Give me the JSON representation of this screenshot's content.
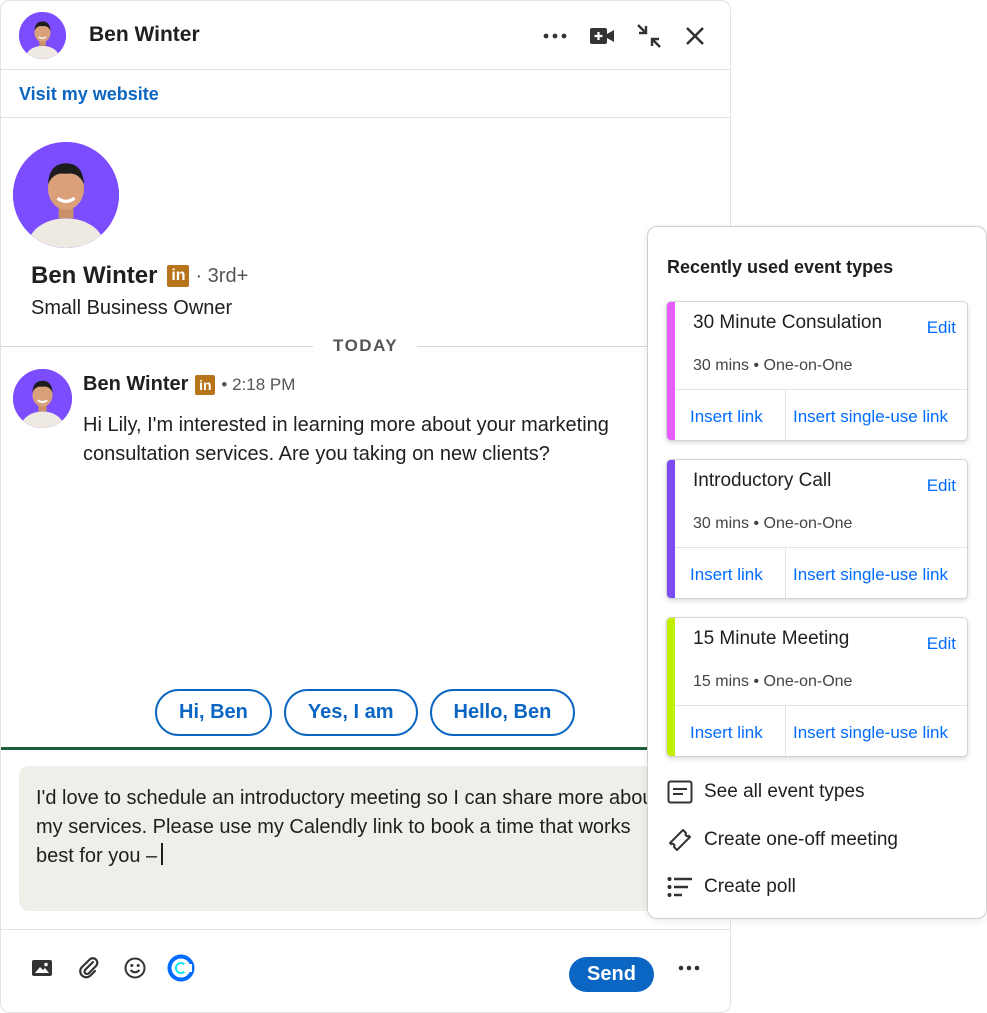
{
  "header": {
    "name": "Ben Winter",
    "more_icon": "ellipsis-icon",
    "video_icon": "video-call-icon",
    "minimize_icon": "collapse-arrows-icon",
    "close_icon": "close-icon"
  },
  "website_link": "Visit my website",
  "profile": {
    "name": "Ben Winter",
    "badge": "in",
    "degree": "· 3rd+",
    "title": "Small Business Owner"
  },
  "day_divider": "TODAY",
  "message": {
    "sender": "Ben Winter",
    "badge": "in",
    "time": "• 2:18 PM",
    "body": "Hi Lily, I'm interested in learning more about your marketing consultation services. Are you taking on new clients?"
  },
  "suggestions": [
    "Hi, Ben",
    "Yes, I am",
    "Hello, Ben"
  ],
  "compose": {
    "text": "I'd love to schedule an introductory meeting so I can share more about my services. Please use my Calendly link to book a time that works best for you –"
  },
  "toolbar": {
    "send_label": "Send",
    "icons": [
      "image-icon",
      "attachment-icon",
      "emoji-icon",
      "calendly-icon",
      "more-icon"
    ]
  },
  "calendly_popup": {
    "title": "Recently used event types",
    "events": [
      {
        "name": "30 Minute Consulation",
        "edit": "Edit",
        "meta": "30 mins • One-on-One",
        "insert": "Insert link",
        "insert_single": "Insert single-use link",
        "color": "#e55cff"
      },
      {
        "name": "Introductory Call",
        "edit": "Edit",
        "meta": "30 mins • One-on-One",
        "insert": "Insert link",
        "insert_single": "Insert single-use link",
        "color": "#7b4cf4"
      },
      {
        "name": "15 Minute Meeting",
        "edit": "Edit",
        "meta": "15 mins • One-on-One",
        "insert": "Insert link",
        "insert_single": "Insert single-use link",
        "color": "#c2ef00"
      }
    ],
    "menu": [
      {
        "label": "See all event types",
        "icon": "event-list-icon"
      },
      {
        "label": "Create one-off meeting",
        "icon": "ticket-icon"
      },
      {
        "label": "Create poll",
        "icon": "poll-icon"
      }
    ]
  },
  "colors": {
    "linkedin_blue": "#0a66c2",
    "calendly_blue": "#006bff",
    "avatar_purple": "#7c4dff",
    "compose_bg": "#f0eee9",
    "compose_accent": "#1f5e3a"
  }
}
